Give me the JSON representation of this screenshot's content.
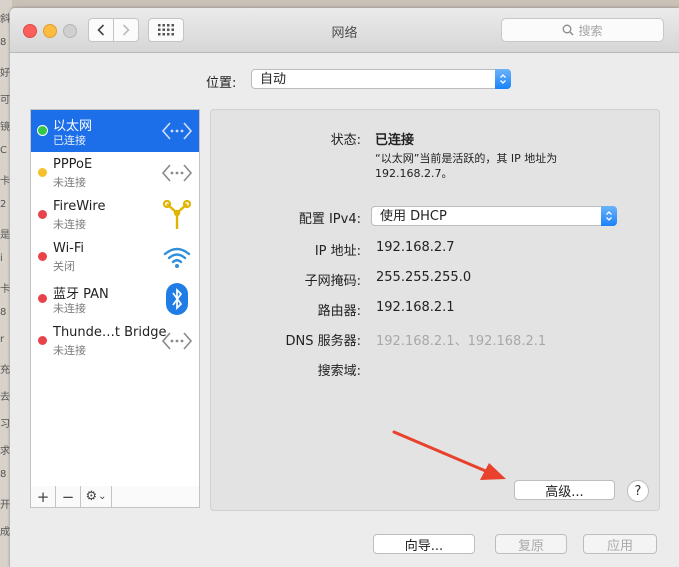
{
  "window": {
    "title": "网络"
  },
  "search": {
    "placeholder": "搜索"
  },
  "location": {
    "label": "位置:",
    "value": "自动"
  },
  "services": [
    {
      "name": "以太网",
      "status": "已连接",
      "dot": "#34c84a",
      "icon": "ethernet-icon",
      "selected": true
    },
    {
      "name": "PPPoE",
      "status": "未连接",
      "dot": "#f5c02c",
      "icon": "ethernet-icon",
      "selected": false
    },
    {
      "name": "FireWire",
      "status": "未连接",
      "dot": "#e8434a",
      "icon": "firewire-icon",
      "selected": false
    },
    {
      "name": "Wi-Fi",
      "status": "关闭",
      "dot": "#e8434a",
      "icon": "wifi-icon",
      "selected": false
    },
    {
      "name": "蓝牙 PAN",
      "status": "未连接",
      "dot": "#e8434a",
      "icon": "bluetooth-icon",
      "selected": false
    },
    {
      "name": "Thunde…t Bridge",
      "status": "未连接",
      "dot": "#e8434a",
      "icon": "ethernet-icon",
      "selected": false
    }
  ],
  "list_toolbar": {
    "add": "+",
    "remove": "−",
    "gear": "⚙",
    "chevron": "⌄"
  },
  "details": {
    "status_label": "状态:",
    "status_value": "已连接",
    "status_note_1": "“以太网”当前是活跃的，其 IP 地址为",
    "status_note_2": "192.168.2.7。",
    "ipv4_label": "配置 IPv4:",
    "ipv4_value": "使用 DHCP",
    "ip_label": "IP 地址:",
    "ip_value": "192.168.2.7",
    "mask_label": "子网掩码:",
    "mask_value": "255.255.255.0",
    "router_label": "路由器:",
    "router_value": "192.168.2.1",
    "dns_label": "DNS 服务器:",
    "dns_value": "192.168.2.1、192.168.2.1",
    "search_domain_label": "搜索域:"
  },
  "buttons": {
    "advanced": "高级...",
    "help": "?",
    "assistant": "向导...",
    "revert": "复原",
    "apply": "应用"
  },
  "colors": {
    "accent": "#1c6fe9",
    "annotation_arrow": "#e8412c"
  },
  "bg_strip": [
    "斜",
    "8",
    "好",
    "可",
    "镜",
    "C",
    "卡",
    "2",
    "是",
    "i",
    "卡",
    "8",
    "r",
    "充",
    "去",
    "习",
    "求",
    "8",
    "开",
    "成"
  ]
}
